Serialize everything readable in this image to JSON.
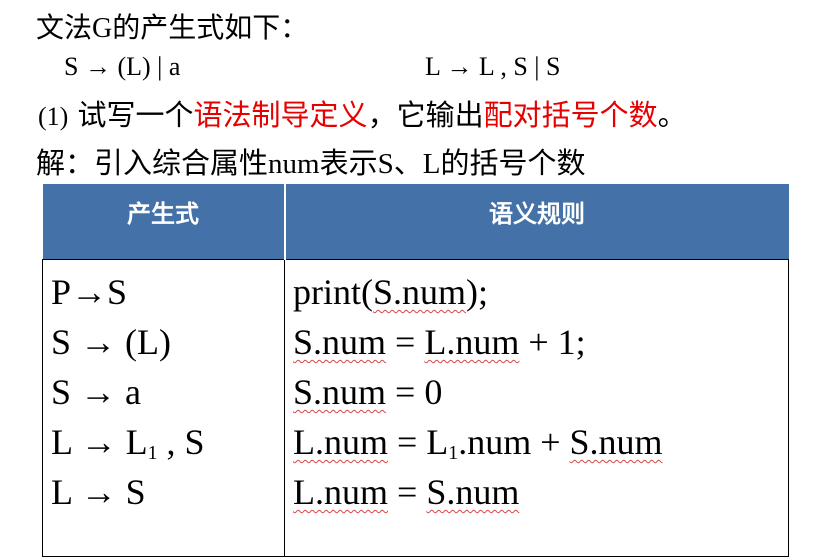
{
  "intro": {
    "prefix": "文法",
    "grammar_name": "G",
    "suffix": "的产生式如下："
  },
  "grammar": {
    "rule_s": "S → (L) | a",
    "rule_l": "L → L , S | S"
  },
  "question": {
    "num": "(1)",
    "text_a": " 试写一个",
    "highlight_a": "语法制导定义",
    "text_b": "，它输出",
    "highlight_b": "配对括号个数",
    "text_c": "。"
  },
  "answer": {
    "text_a": "解：引入综合属性",
    "attr": "num",
    "text_b": "表示",
    "symbol_s": "S",
    "sep": "、",
    "symbol_l": "L",
    "text_c": "的括号个数"
  },
  "table": {
    "headers": [
      "产生式",
      "语义规则"
    ],
    "productions": [
      {
        "lhs": "P",
        "arrow": "→",
        "rhs": "S",
        "sub": "",
        "tail": ""
      },
      {
        "lhs": "S",
        "arrow": " → ",
        "rhs": "(L)",
        "sub": "",
        "tail": ""
      },
      {
        "lhs": "S",
        "arrow": " → ",
        "rhs": "a",
        "sub": "",
        "tail": ""
      },
      {
        "lhs": "L",
        "arrow": " → ",
        "rhs": "L",
        "sub": "1",
        "tail": " , S"
      },
      {
        "lhs": "L",
        "arrow": " → ",
        "rhs": "S",
        "sub": "",
        "tail": ""
      }
    ],
    "rules": [
      {
        "parts": [
          {
            "t": "print(",
            "w": false
          },
          {
            "t": "S.num",
            "w": true
          },
          {
            "t": ");",
            "w": false
          }
        ]
      },
      {
        "parts": [
          {
            "t": "S.num",
            "w": true
          },
          {
            "t": " = ",
            "w": false
          },
          {
            "t": "L.num",
            "w": true
          },
          {
            "t": " + 1;",
            "w": false
          }
        ]
      },
      {
        "parts": [
          {
            "t": "S.num",
            "w": true
          },
          {
            "t": " = 0",
            "w": false
          }
        ]
      },
      {
        "parts": [
          {
            "t": "L.num",
            "w": true
          },
          {
            "t": " = L",
            "w": false
          },
          {
            "t": "1",
            "w": false,
            "sub": true
          },
          {
            "t": ".num + ",
            "w": false
          },
          {
            "t": "S.num",
            "w": true
          }
        ]
      },
      {
        "parts": [
          {
            "t": "L.num",
            "w": true
          },
          {
            "t": " = ",
            "w": false
          },
          {
            "t": "S.num",
            "w": true
          }
        ]
      }
    ]
  },
  "colors": {
    "highlight": "#e60000",
    "header_bg": "#4472a8",
    "spell_underline": "#d64545"
  }
}
